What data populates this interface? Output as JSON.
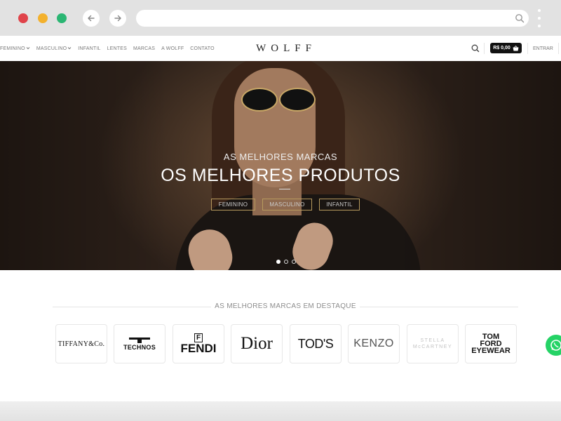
{
  "browser": {
    "dots": [
      {
        "name": "close-dot",
        "color": "#e0434a"
      },
      {
        "name": "minimize-dot",
        "color": "#f3b12d"
      },
      {
        "name": "maximize-dot",
        "color": "#2bb673"
      }
    ]
  },
  "header": {
    "menu": [
      {
        "label": "FEMININO",
        "dropdown": true
      },
      {
        "label": "MASCULINO",
        "dropdown": true
      },
      {
        "label": "INFANTIL",
        "dropdown": false
      },
      {
        "label": "LENTES",
        "dropdown": false
      },
      {
        "label": "MARCAS",
        "dropdown": false
      },
      {
        "label": "A WOLFF",
        "dropdown": false
      },
      {
        "label": "CONTATO",
        "dropdown": false
      }
    ],
    "logo": "WOLFF",
    "cart_label": "R$ 0,00",
    "login_label": "ENTRAR"
  },
  "hero": {
    "kicker": "AS MELHORES MARCAS",
    "headline": "OS MELHORES PRODUTOS",
    "buttons": [
      "FEMININO",
      "MASCULINO",
      "INFANTIL"
    ],
    "slides": 3,
    "active_slide": 1
  },
  "brands": {
    "title": "AS MELHORES MARCAS EM DESTAQUE",
    "items": [
      "TIFFANY&Co.",
      "TECHNOS",
      "FENDI",
      "Dior",
      "TOD'S",
      "KENZO",
      "STELLA McCARTNEY",
      "TOM FORD EYEWEAR"
    ]
  },
  "colors": {
    "accent": "#b79a5e",
    "whatsapp": "#25d366",
    "cart_bg": "#111111"
  }
}
